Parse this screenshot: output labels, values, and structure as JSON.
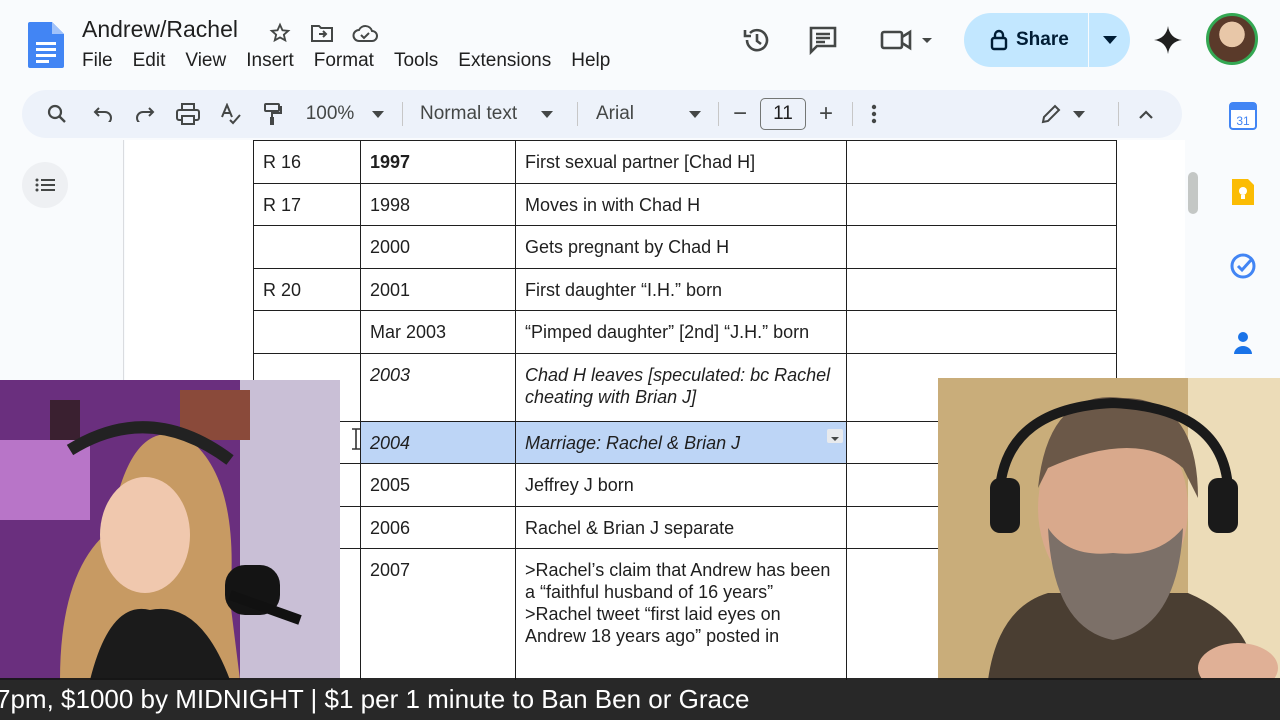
{
  "app": {
    "doc_title": "Andrew/Rachel",
    "menu": [
      "File",
      "Edit",
      "View",
      "Insert",
      "Format",
      "Tools",
      "Extensions",
      "Help"
    ],
    "share_label": "Share"
  },
  "toolbar": {
    "zoom": "100%",
    "style": "Normal text",
    "font": "Arial",
    "font_size": "11",
    "minus": "−",
    "plus": "+"
  },
  "table": {
    "rows": [
      {
        "c1": "R 16",
        "c2": "1997",
        "c3": "First sexual partner [Chad H]",
        "c4": ""
      },
      {
        "c1": "R 17",
        "c2": "1998",
        "c3": "Moves in with Chad H",
        "c4": ""
      },
      {
        "c1": "",
        "c2": "2000",
        "c3": "Gets pregnant by Chad H",
        "c4": ""
      },
      {
        "c1": "R 20",
        "c2": "2001",
        "c3": "First daughter “I.H.” born",
        "c4": ""
      },
      {
        "c1": "",
        "c2": "Mar 2003",
        "c3": "“Pimped daughter” [2nd] “J.H.” born",
        "c4": ""
      },
      {
        "c1": "",
        "c2": "2003",
        "c3": "Chad H leaves [speculated: bc Rachel cheating with Brian J]",
        "c4": ""
      },
      {
        "c1": "",
        "c2": "2004",
        "c3": "Marriage: Rachel & Brian J",
        "c4": ""
      },
      {
        "c1": "",
        "c2": "2005",
        "c3": "Jeffrey J born",
        "c4": ""
      },
      {
        "c1": "",
        "c2": "2006",
        "c3": "Rachel & Brian J separate",
        "c4": ""
      },
      {
        "c1": "",
        "c2": "2007",
        "c3a": ">Rachel’s claim that Andrew has been a “faithful husband of 16 years”",
        "c3b": ">Rachel tweet “first laid eyes on Andrew 18 years ago” posted in",
        "c4": ""
      }
    ]
  },
  "ticker": {
    "text": "7pm, $1000 by MIDNIGHT | $1 per 1 minute to Ban Ben or Grace"
  },
  "colors": {
    "share_bg": "#c2e7ff",
    "selection": "#bdd5f6",
    "toolbar_bg": "#edf2fa"
  }
}
